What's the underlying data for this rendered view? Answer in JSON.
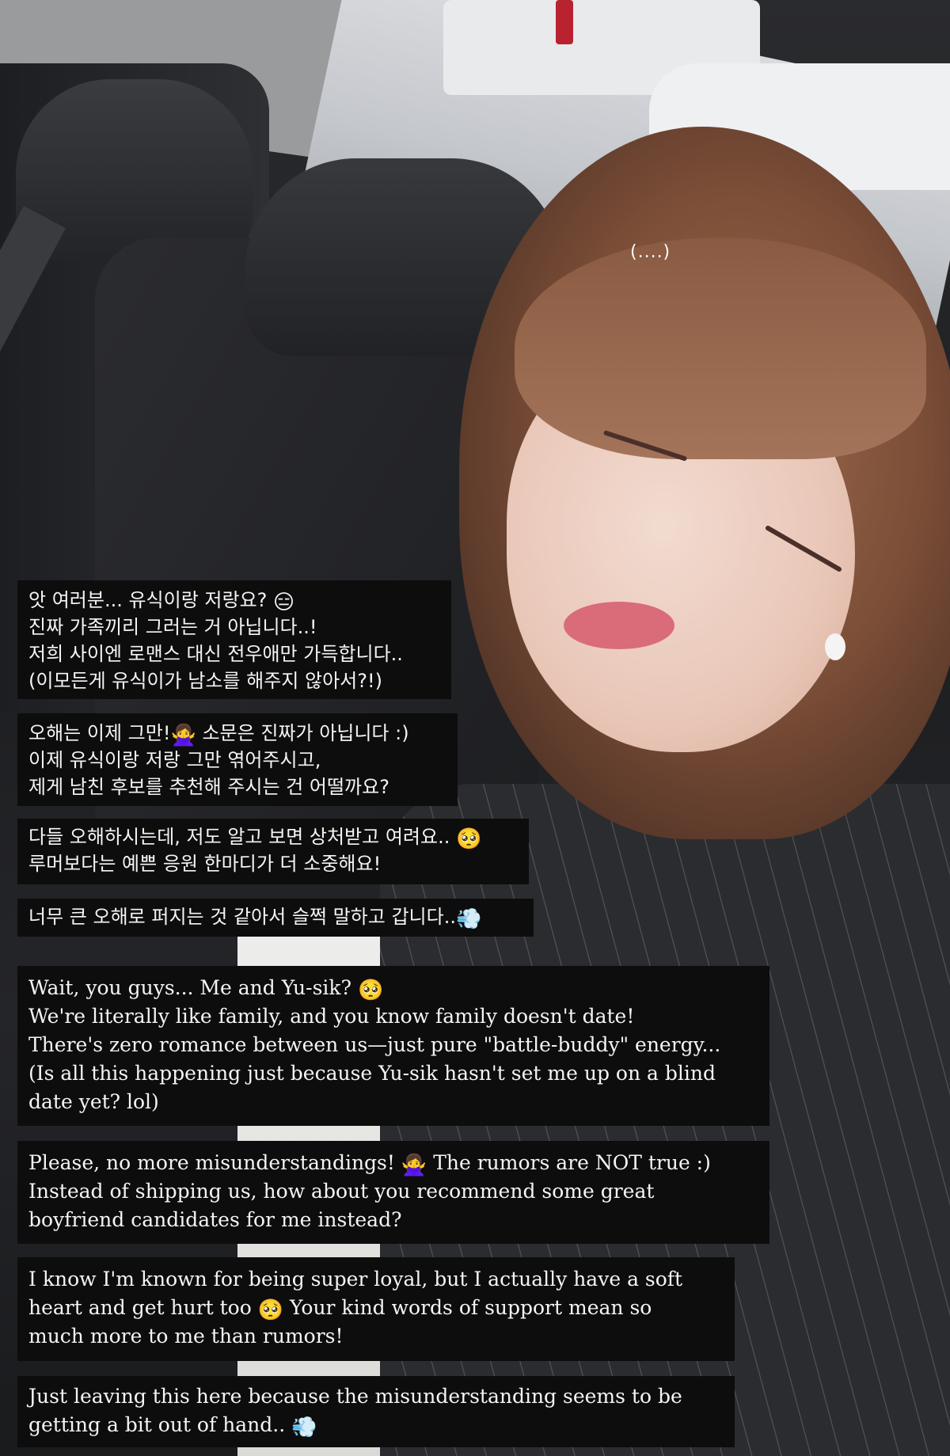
{
  "overlay_caption": "(....)",
  "korean_blocks": [
    {
      "lines": [
        {
          "text": "앗 여러분... 유식이랑 저랑요? ",
          "emoji": "😑"
        },
        {
          "text": "진짜 가족끼리 그러는 거 아닙니다..!",
          "emoji": ""
        },
        {
          "text": "저희 사이엔 로맨스 대신 전우애만 가득합니다..",
          "emoji": ""
        },
        {
          "text": "(이모든게 유식이가 남소를 해주지 않아서?!)",
          "emoji": ""
        }
      ]
    },
    {
      "lines": [
        {
          "text": "오해는 이제 그만!",
          "emoji": "🙅‍♀️",
          "after": " 소문은 진짜가 아닙니다 :)"
        },
        {
          "text": "이제 유식이랑 저랑 그만 엮어주시고,",
          "emoji": ""
        },
        {
          "text": "제게 남친 후보를 추천해 주시는 건 어떨까요?",
          "emoji": ""
        }
      ]
    },
    {
      "lines": [
        {
          "text": "다들 오해하시는데, 저도 알고 보면 상처받고 여려요.. ",
          "emoji": "🥺"
        },
        {
          "text": "루머보다는 예쁜 응원 한마디가 더 소중해요!",
          "emoji": ""
        }
      ]
    },
    {
      "lines": [
        {
          "text": "너무 큰 오해로 퍼지는 것 같아서 슬쩍 말하고 갑니다..",
          "emoji": "💨"
        }
      ]
    }
  ],
  "english_blocks": [
    {
      "lines": [
        {
          "text": "Wait, you guys... Me and Yu-sik? ",
          "emoji": "🥺"
        },
        {
          "text": "We're literally like family, and you know family doesn't date!",
          "emoji": ""
        },
        {
          "text": "There's zero romance between us—just pure \"battle-buddy\" energy...",
          "emoji": ""
        },
        {
          "text": "(Is all this happening just because Yu-sik hasn't set me up on a blind",
          "emoji": ""
        },
        {
          "text": "date yet? lol)",
          "emoji": ""
        }
      ]
    },
    {
      "lines": [
        {
          "text": "Please, no more misunderstandings! ",
          "emoji": "🙅‍♀️",
          "after": " The rumors are NOT true :)"
        },
        {
          "text": "Instead of shipping us, how about you recommend some great",
          "emoji": ""
        },
        {
          "text": "boyfriend candidates for me instead?",
          "emoji": ""
        }
      ]
    },
    {
      "lines": [
        {
          "text": "I know I'm known for being super loyal, but I actually have a soft",
          "emoji": ""
        },
        {
          "text": "heart and get hurt too ",
          "emoji": "🥺",
          "after": " Your kind words of support mean so"
        },
        {
          "text": "much more to me than rumors!",
          "emoji": ""
        }
      ]
    },
    {
      "lines": [
        {
          "text": "Just leaving this here because the misunderstanding seems to be",
          "emoji": ""
        },
        {
          "text": "getting a bit out of hand.. ",
          "emoji": "💨"
        }
      ]
    }
  ]
}
